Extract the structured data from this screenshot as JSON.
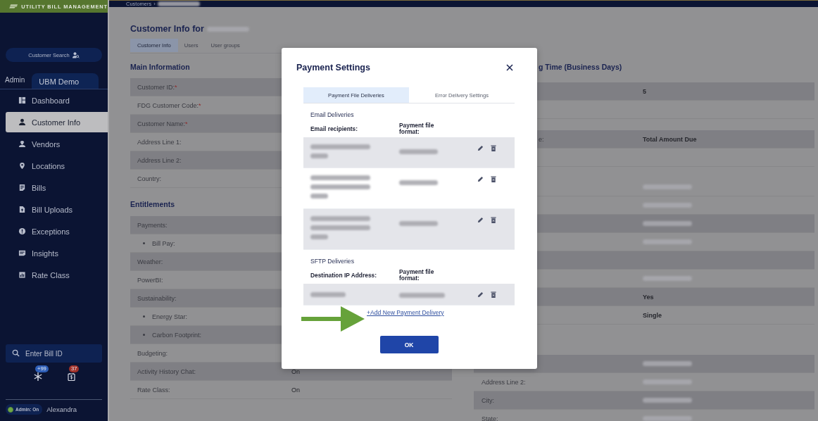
{
  "app": {
    "logo": "UTILITY BILL MANAGEMENT"
  },
  "breadcrumb": {
    "items": [
      "Customers"
    ],
    "separator": "›"
  },
  "sidebar": {
    "search_button": "Customer Search",
    "tabs": [
      {
        "label": "Admin",
        "selected": false
      },
      {
        "label": "UBM Demo",
        "selected": true
      }
    ],
    "items": [
      {
        "label": "Dashboard",
        "kind": "dashboard",
        "selected": false
      },
      {
        "label": "Customer Info",
        "kind": "person",
        "selected": true
      },
      {
        "label": "Vendors",
        "kind": "worker",
        "selected": false
      },
      {
        "label": "Locations",
        "kind": "pin",
        "selected": false
      },
      {
        "label": "Bills",
        "kind": "doc",
        "selected": false
      },
      {
        "label": "Bill Uploads",
        "kind": "upload",
        "selected": false
      },
      {
        "label": "Exceptions",
        "kind": "alert",
        "selected": false
      },
      {
        "label": "Insights",
        "kind": "note",
        "selected": false
      },
      {
        "label": "Rate Class",
        "kind": "chart",
        "selected": false
      }
    ],
    "bill_search": {
      "placeholder": "Enter Bill ID"
    },
    "notifications": [
      {
        "kind": "asterisk",
        "badge": "+99",
        "color": "#2f5fb8"
      },
      {
        "kind": "bill",
        "badge": "37",
        "color": "#a03028"
      }
    ],
    "admin_toggle": {
      "label": "Admin: On",
      "on": true
    },
    "user": "Alexandra"
  },
  "page": {
    "title": "Customer Info for",
    "tabs": [
      {
        "label": "Customer Info",
        "selected": true
      },
      {
        "label": "Users",
        "selected": false
      },
      {
        "label": "User groups",
        "selected": false
      }
    ],
    "main_information": {
      "heading": "Main Information",
      "rows": [
        {
          "label": "Customer ID:",
          "required_mark": "*"
        },
        {
          "label": "FDG Customer Code:",
          "required_mark": "*"
        },
        {
          "label": "Customer Name:",
          "required_mark": "*"
        },
        {
          "label": "Address Line 1:"
        },
        {
          "label": "Address Line 2:"
        },
        {
          "label": "Country:"
        }
      ]
    },
    "entitlements": {
      "heading": "Entitlements",
      "rows": [
        {
          "label": "Payments:",
          "children": [
            {
              "label": "Bill Pay:"
            }
          ]
        },
        {
          "label": "Weather:"
        },
        {
          "label": "PowerBI:"
        },
        {
          "label": "Sustainability:",
          "children": [
            {
              "label": "Energy Star:"
            },
            {
              "label": "Carbon Footprint:"
            }
          ]
        },
        {
          "label": "Budgeting:"
        },
        {
          "label": "Activity History Chat:",
          "value": "On"
        },
        {
          "label": "Rate Class:",
          "value": "On"
        }
      ]
    },
    "right_column": {
      "heading": "g Time (Business Days)",
      "rows": [
        {
          "kind": "row",
          "shaded": true,
          "value": "5"
        },
        {
          "kind": "row",
          "shaded": false
        },
        {
          "kind": "gap"
        },
        {
          "kind": "row",
          "shaded": true,
          "label_cut": "e:",
          "value": "Total Amount Due"
        },
        {
          "kind": "row",
          "shaded": false
        },
        {
          "kind": "gap"
        },
        {
          "kind": "row",
          "shaded": false,
          "redacted": true
        },
        {
          "kind": "row",
          "shaded": false,
          "redacted": true
        },
        {
          "kind": "row",
          "shaded": true,
          "redacted": true
        },
        {
          "kind": "row",
          "shaded": false,
          "redacted": true
        },
        {
          "kind": "row",
          "shaded": true
        },
        {
          "kind": "row",
          "shaded": false,
          "redacted": true
        },
        {
          "kind": "row",
          "shaded": true,
          "value": "Yes"
        },
        {
          "kind": "row",
          "shaded": false,
          "value": "Single"
        },
        {
          "kind": "break"
        },
        {
          "kind": "row",
          "shaded": true,
          "redacted": true
        },
        {
          "kind": "row",
          "shaded": false,
          "label": "Address Line 2:",
          "redacted": true
        },
        {
          "kind": "row",
          "shaded": true,
          "label": "City:",
          "redacted": true
        },
        {
          "kind": "row",
          "shaded": false,
          "label": "State:",
          "redacted": true
        }
      ]
    }
  },
  "modal": {
    "title": "Payment Settings",
    "tabs": [
      {
        "label": "Payment File Deliveries",
        "selected": true
      },
      {
        "label": "Error Delivery Settings",
        "selected": false
      }
    ],
    "sections": [
      {
        "heading": "Email Deliveries",
        "columns": [
          "Email recipients:",
          "Payment file format:"
        ],
        "rows": [
          {
            "kind": "short"
          },
          {
            "kind": "long"
          },
          {
            "kind": "long"
          }
        ]
      },
      {
        "heading": "SFTP Deliveries",
        "columns": [
          "Destination IP Address:",
          "Payment file format:"
        ],
        "rows": [
          {
            "kind": "single"
          }
        ]
      }
    ],
    "add_link": "+Add New Payment Delivery",
    "ok_button": "OK"
  }
}
